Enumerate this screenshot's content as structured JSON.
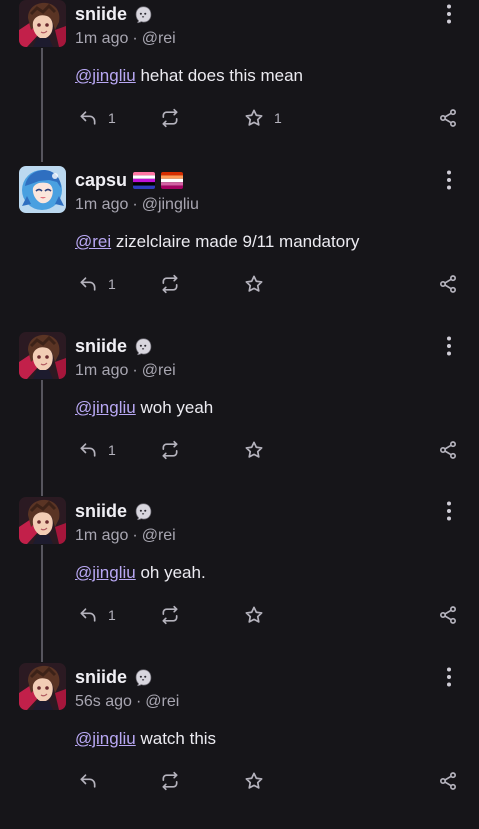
{
  "posts": [
    {
      "name": "sniide",
      "time": "1m ago",
      "handle": "@rei",
      "mention": "@jingliu",
      "text": " hehat does this mean",
      "reply_count": "1",
      "fav_count": "1",
      "avatar": "sniide",
      "badges": [
        "ghost-badge"
      ]
    },
    {
      "name": "capsu",
      "time": "1m ago",
      "handle": "@jingliu",
      "mention": "@rei",
      "text": " zizelclaire made 9/11 mandatory",
      "reply_count": "1",
      "fav_count": "",
      "avatar": "capsu",
      "badges": [
        "genderfluid-flag",
        "lesbian-flag"
      ]
    },
    {
      "name": "sniide",
      "time": "1m ago",
      "handle": "@rei",
      "mention": "@jingliu",
      "text": " woh yeah",
      "reply_count": "1",
      "fav_count": "",
      "avatar": "sniide",
      "badges": [
        "ghost-badge"
      ]
    },
    {
      "name": "sniide",
      "time": "1m ago",
      "handle": "@rei",
      "mention": "@jingliu",
      "text": " oh yeah.",
      "reply_count": "1",
      "fav_count": "",
      "avatar": "sniide",
      "badges": [
        "ghost-badge"
      ]
    },
    {
      "name": "sniide",
      "time": "56s ago",
      "handle": "@rei",
      "mention": "@jingliu",
      "text": " watch this",
      "reply_count": "",
      "fav_count": "",
      "avatar": "sniide",
      "badges": [
        "ghost-badge"
      ]
    }
  ],
  "meta_separator": "·",
  "colors": {
    "background": "#161519",
    "mention": "#b9a8f4",
    "muted": "#a8a6b1",
    "thread_line": "#57555e"
  }
}
